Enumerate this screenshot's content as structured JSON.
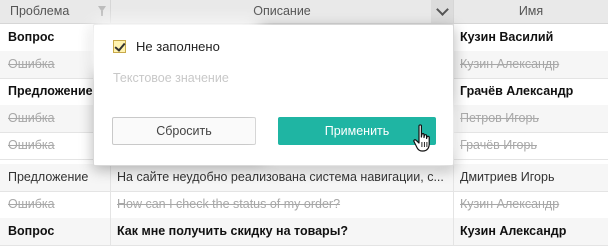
{
  "columns": [
    {
      "label": "Проблема"
    },
    {
      "label": "Описание"
    },
    {
      "label": "Имя"
    }
  ],
  "rows": [
    {
      "type": "Вопрос",
      "description": "",
      "name": "Кузин Василий",
      "style": "bold"
    },
    {
      "type": "Ошибка",
      "description": "",
      "name": "Кузин Александр",
      "style": "strike"
    },
    {
      "type": "Предложение",
      "description": "",
      "name": "Грачёв Александр",
      "style": "bold"
    },
    {
      "type": "Ошибка",
      "description": "",
      "name": "Петров Игорь",
      "style": "strike"
    },
    {
      "type": "Ошибка",
      "description": "",
      "name": "Грачёв Игорь",
      "style": "strike"
    },
    {
      "type": "Предложение",
      "description": "На сайте неудобно реализована система навигации, с...",
      "name": "Дмитриев Игорь",
      "style": "normal"
    },
    {
      "type": "Ошибка",
      "description": "How can I check the status of my order?",
      "name": "Кузин Александр",
      "style": "strike"
    },
    {
      "type": "Вопрос",
      "description": "Как мне получить скидку на товары?",
      "name": "Кузин Александр",
      "style": "bold"
    }
  ],
  "filter_popup": {
    "checkbox_label": "Не заполнено",
    "checkbox_checked": true,
    "input_placeholder": "Текстовое значение",
    "reset_label": "Сбросить",
    "apply_label": "Применить"
  },
  "icons": [
    "filter-icon",
    "chevron-down-icon",
    "check-icon",
    "hand-cursor-icon"
  ],
  "colors": {
    "accent": "#1fb5a3",
    "checkbox_fill": "#fff3b0",
    "header_bg": "#e9e9e9"
  }
}
